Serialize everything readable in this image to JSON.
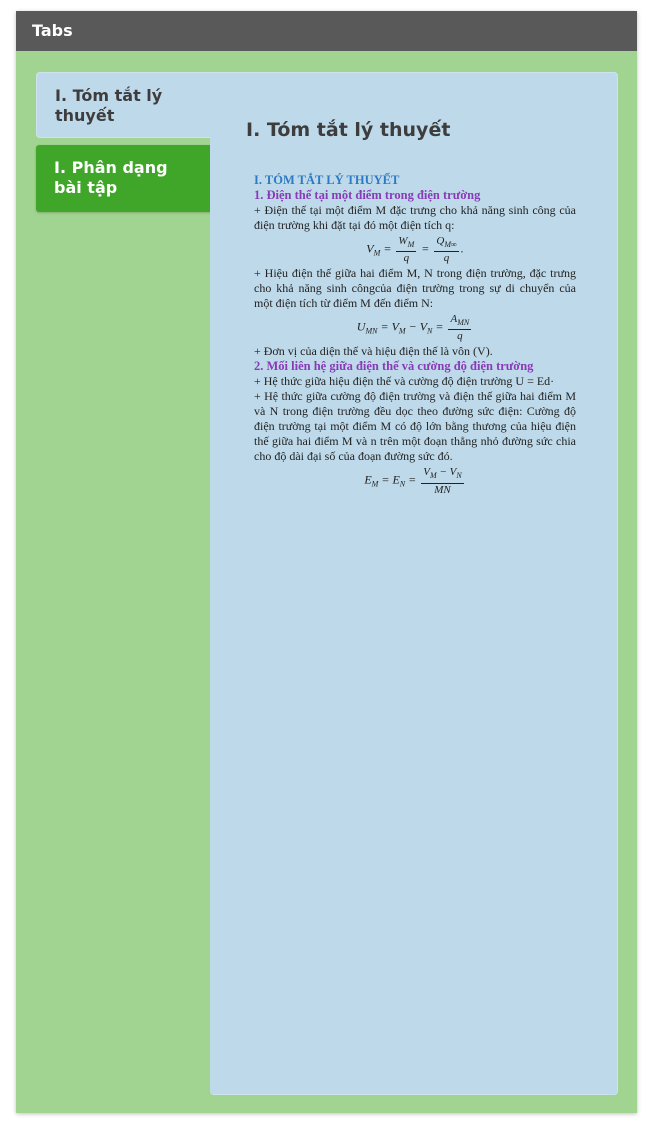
{
  "header": {
    "title": "Tabs"
  },
  "tabs": [
    {
      "label": "I. Tóm tắt lý thuyết",
      "active": true
    },
    {
      "label": "I. Phân dạng bài tập",
      "active": false
    }
  ],
  "panel": {
    "title": "I. Tóm tắt lý thuyết",
    "doc": {
      "heading": "I. TÓM TẮT LÝ THUYẾT",
      "sub1": "1. Điện thế tại một điểm trong điện trường",
      "p1": "+ Điện thế tại một điểm M đặc trưng cho khả năng sinh công của điện trường khi đặt tại đó một điện tích q:",
      "eq1": {
        "lhs": "V",
        "lhs_sub": "M",
        "num1": "W",
        "num1_sub": "M",
        "den1": "q",
        "num2": "Q",
        "num2_sub": "M∞",
        "den2": "q"
      },
      "p2": "+ Hiệu điện thế giữa hai điểm M, N trong điện trường, đặc trưng cho khả năng sinh côngcủa điện trường trong sự di chuyển của một điện tích từ điểm M đến điểm N:",
      "eq2": {
        "lhs": "U",
        "lhs_sub": "MN",
        "v1": "V",
        "v1_sub": "M",
        "v2": "V",
        "v2_sub": "N",
        "num": "A",
        "num_sub": "MN",
        "den": "q"
      },
      "p3": "+ Đơn vị của diện thế và hiệu điện thế là vôn (V).",
      "sub2": "2. Mối liên hệ giữa điện thế và cường độ điện trường",
      "p4": "+ Hệ thức giữa hiệu điện thế và cường độ điện trường U = Ed·",
      "p5": "+ Hệ thức giữa cường độ điện trường và điện thế giữa hai điểm M và N trong điện trường đều dọc theo đường sức điện: Cường độ điện trường tại một điểm M có độ lớn bằng thương của hiệu điện thế giữa hai điểm M và n trên một đoạn thẳng nhỏ đường sức chia cho độ dài đại số của đoạn đường sức đó.",
      "eq3": {
        "l1": "E",
        "l1_sub": "M",
        "l2": "E",
        "l2_sub": "N",
        "num_a": "V",
        "num_a_sub": "M",
        "num_b": "V",
        "num_b_sub": "N",
        "den": "MN"
      }
    }
  },
  "colors": {
    "frame_bg": "#a1d490",
    "header_bg": "#595959",
    "active_tab_bg": "#bedaea",
    "inactive_tab_bg": "#3fa62a",
    "heading_blue": "#2e79c4",
    "heading_purple": "#8a3ab8"
  }
}
